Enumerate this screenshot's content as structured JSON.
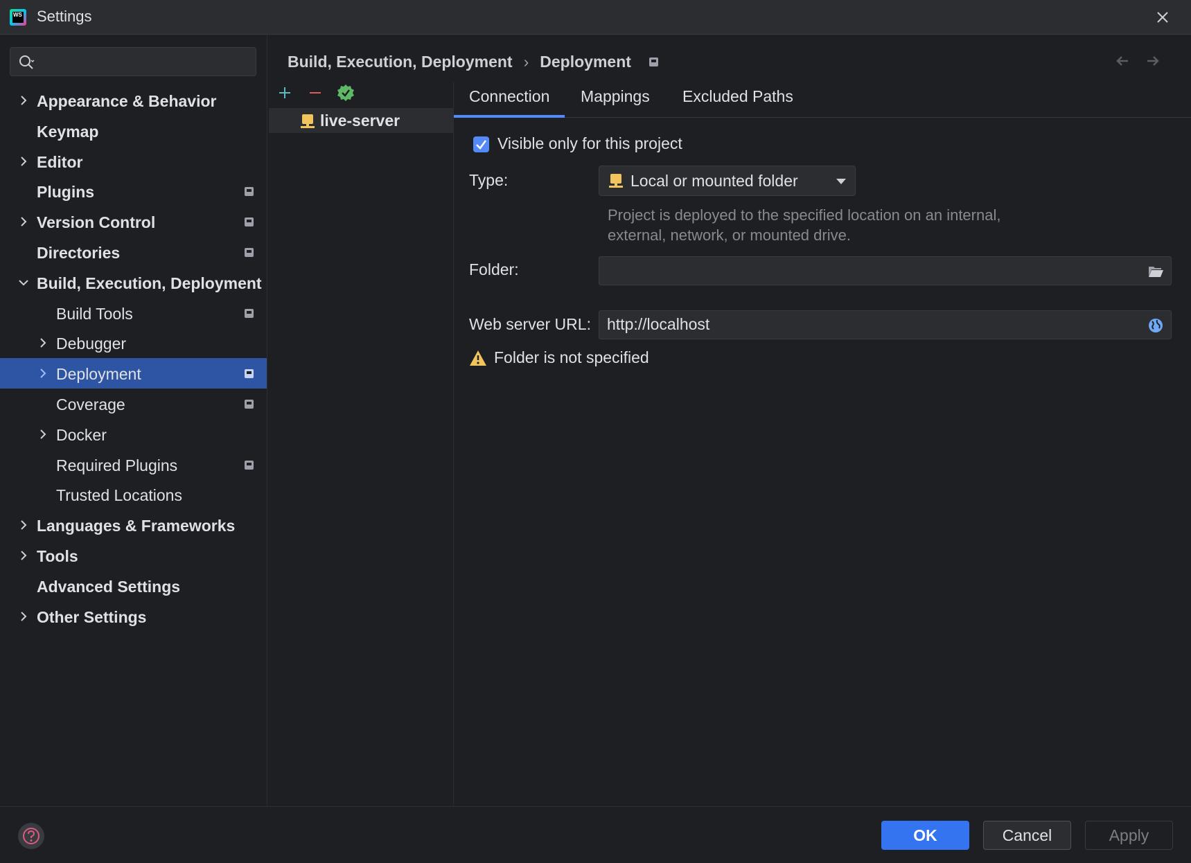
{
  "window": {
    "title": "Settings",
    "logo_text": "WS"
  },
  "search": {
    "placeholder": "",
    "value": ""
  },
  "sidebar": {
    "items": [
      {
        "label": "Appearance & Behavior",
        "bold": true,
        "expandable": true,
        "expanded": false,
        "level": 0,
        "project_badge": false
      },
      {
        "label": "Keymap",
        "bold": true,
        "expandable": false,
        "level": 0,
        "project_badge": false
      },
      {
        "label": "Editor",
        "bold": true,
        "expandable": true,
        "expanded": false,
        "level": 0,
        "project_badge": false
      },
      {
        "label": "Plugins",
        "bold": true,
        "expandable": false,
        "level": 0,
        "project_badge": true
      },
      {
        "label": "Version Control",
        "bold": true,
        "expandable": true,
        "expanded": false,
        "level": 0,
        "project_badge": true
      },
      {
        "label": "Directories",
        "bold": true,
        "expandable": false,
        "level": 0,
        "project_badge": true
      },
      {
        "label": "Build, Execution, Deployment",
        "bold": true,
        "expandable": true,
        "expanded": true,
        "level": 0,
        "project_badge": false
      },
      {
        "label": "Build Tools",
        "bold": false,
        "expandable": false,
        "level": 1,
        "project_badge": true
      },
      {
        "label": "Debugger",
        "bold": false,
        "expandable": true,
        "expanded": false,
        "level": 1,
        "project_badge": false
      },
      {
        "label": "Deployment",
        "bold": false,
        "expandable": true,
        "expanded": false,
        "level": 1,
        "project_badge": true,
        "selected": true
      },
      {
        "label": "Coverage",
        "bold": false,
        "expandable": false,
        "level": 1,
        "project_badge": true
      },
      {
        "label": "Docker",
        "bold": false,
        "expandable": true,
        "expanded": false,
        "level": 1,
        "project_badge": false
      },
      {
        "label": "Required Plugins",
        "bold": false,
        "expandable": false,
        "level": 1,
        "project_badge": true
      },
      {
        "label": "Trusted Locations",
        "bold": false,
        "expandable": false,
        "level": 1,
        "project_badge": false
      },
      {
        "label": "Languages & Frameworks",
        "bold": true,
        "expandable": true,
        "expanded": false,
        "level": 0,
        "project_badge": false
      },
      {
        "label": "Tools",
        "bold": true,
        "expandable": true,
        "expanded": false,
        "level": 0,
        "project_badge": false
      },
      {
        "label": "Advanced Settings",
        "bold": true,
        "expandable": false,
        "level": 0,
        "project_badge": false
      },
      {
        "label": "Other Settings",
        "bold": true,
        "expandable": true,
        "expanded": false,
        "level": 0,
        "project_badge": false
      }
    ]
  },
  "breadcrumb": {
    "parent": "Build, Execution, Deployment",
    "separator": "›",
    "current": "Deployment"
  },
  "servers": {
    "items": [
      {
        "label": "live-server"
      }
    ]
  },
  "tabs": [
    {
      "label": "Connection",
      "active": true
    },
    {
      "label": "Mappings"
    },
    {
      "label": "Excluded Paths"
    }
  ],
  "form": {
    "visible_only_label": "Visible only for this project",
    "visible_only_checked": true,
    "type_label": "Type:",
    "type_value": "Local or mounted folder",
    "type_help": "Project is deployed to the specified location on an internal, external, network, or mounted drive.",
    "folder_label": "Folder:",
    "folder_value": "",
    "url_label": "Web server URL:",
    "url_value": "http://localhost",
    "warning": "Folder is not specified"
  },
  "buttons": {
    "ok": "OK",
    "cancel": "Cancel",
    "apply": "Apply"
  },
  "colors": {
    "accent": "#548af7",
    "selection": "#2e55a3",
    "add": "#5fb8c4",
    "remove": "#db5c5c",
    "check": "#5fb865",
    "server_icon": "#f2c55c",
    "warning": "#f2c55c"
  }
}
